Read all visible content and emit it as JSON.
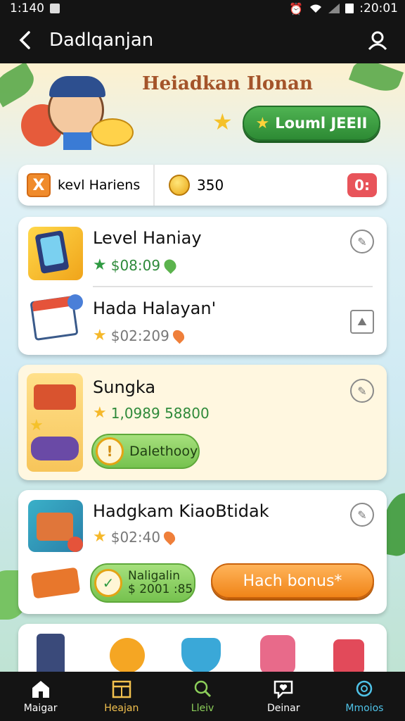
{
  "status": {
    "time": "1:140",
    "clock": ":20:01"
  },
  "app": {
    "title": "Dadlqanjan"
  },
  "hero": {
    "title": "Heiadkan Ilonan",
    "cta": "Louml JEEII"
  },
  "stats": {
    "badge": "X",
    "label": "kevl Hariens",
    "coins": "350",
    "timer": "0:"
  },
  "card1": {
    "items": [
      {
        "title": "Level Haniay",
        "price": "$08:09"
      },
      {
        "title": "Hada Halayan'",
        "price": "$02:209"
      }
    ]
  },
  "card2": {
    "title": "Sungka",
    "price": "1,0989 58800",
    "button": "Dalethooy",
    "button_icon": "!"
  },
  "card3": {
    "title": "Hadgkam KiaoBtidak",
    "price": "$02:40",
    "claim_line1": "Naligalin",
    "claim_line2": "$ 2001 :85",
    "bonus": "Hach bonus*"
  },
  "nav": [
    {
      "label": "Maigar",
      "color": "#ffffff",
      "icon": "home-icon"
    },
    {
      "label": "Heajan",
      "color": "#f2c14e",
      "icon": "calendar-icon"
    },
    {
      "label": "Lleiv",
      "color": "#8ccf5a",
      "icon": "search-icon"
    },
    {
      "label": "Deinar",
      "color": "#ffffff",
      "icon": "heart-chat-icon"
    },
    {
      "label": "Mmoios",
      "color": "#4fc3e8",
      "icon": "refresh-globe-icon"
    }
  ]
}
